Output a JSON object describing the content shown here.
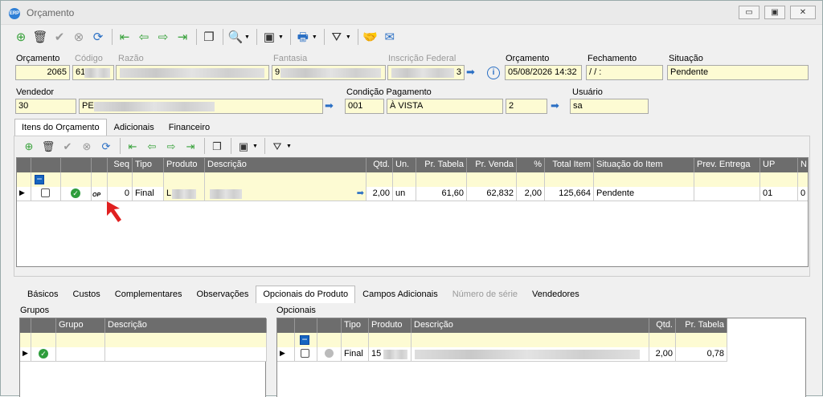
{
  "window": {
    "title": "Orçamento",
    "app_icon": "ERP",
    "minimize": "▭",
    "restore": "▣",
    "close": "✕"
  },
  "toolbar_icons": [
    "add-icon",
    "delete-icon",
    "confirm-icon",
    "cancel-icon",
    "refresh-icon",
    "first-icon",
    "prev-icon",
    "next-icon",
    "last-icon",
    "copy-icon",
    "search-icon",
    "print-preview-icon",
    "print-icon",
    "filter-icon",
    "handshake-icon",
    "email-icon"
  ],
  "header": {
    "orcamento_label": "Orçamento",
    "orcamento_value": "2065",
    "codigo_label": "Código",
    "codigo_value": "61",
    "razao_label": "Razão",
    "fantasia_label": "Fantasia",
    "fantasia_value": "9",
    "inscricao_label": "Inscrição Federal",
    "inscricao_value": "3",
    "orcamento_date_label": "Orçamento",
    "orcamento_date_value": "05/08/2026 14:32",
    "fechamento_label": "Fechamento",
    "fechamento_value": " / /       :",
    "situacao_label": "Situação",
    "situacao_value": "Pendente",
    "vendedor_label": "Vendedor",
    "vendedor_code": "30",
    "vendedor_name": "PE",
    "condicao_label": "Condição Pagamento",
    "condicao_code": "001",
    "condicao_name": "À VISTA",
    "condicao_extra": "2",
    "usuario_label": "Usuário",
    "usuario_value": "sa"
  },
  "main_tabs": [
    "Itens do Orçamento",
    "Adicionais",
    "Financeiro"
  ],
  "items_grid": {
    "columns": [
      "Seq",
      "Tipo",
      "Produto",
      "Descrição",
      "Qtd.",
      "Un.",
      "Pr. Tabela",
      "Pr. Venda",
      "%",
      "Total Item",
      "Situação do Item",
      "Prev. Entrega",
      "UP",
      "N"
    ],
    "row": {
      "op": "OP",
      "seq": "0",
      "tipo": "Final",
      "produto": "L",
      "descricao": "",
      "qtd": "2,00",
      "un": "un",
      "pr_tabela": "61,60",
      "pr_venda": "62,832",
      "pct": "2,00",
      "total": "125,664",
      "situacao": "Pendente",
      "prev": "",
      "up": "01",
      "n": "0"
    }
  },
  "bottom_tabs": [
    "Básicos",
    "Custos",
    "Complementares",
    "Observações",
    "Opcionais do Produto",
    "Campos Adicionais",
    "Número de série",
    "Vendedores"
  ],
  "grupos": {
    "title": "Grupos",
    "columns": [
      "Grupo",
      "Descrição"
    ]
  },
  "opcionais": {
    "title": "Opcionais",
    "columns": [
      "Tipo",
      "Produto",
      "Descrição",
      "Qtd.",
      "Pr. Tabela"
    ],
    "row": {
      "tipo": "Final",
      "produto": "15",
      "descricao": "",
      "qtd": "2,00",
      "pr_tabela": "0,78"
    }
  },
  "colors": {
    "field_bg": "#fdfbd3",
    "header_bg": "#6d6d6d",
    "accent": "#2a6fc4",
    "ok": "#2e9d3c",
    "pointer": "#e02020"
  }
}
